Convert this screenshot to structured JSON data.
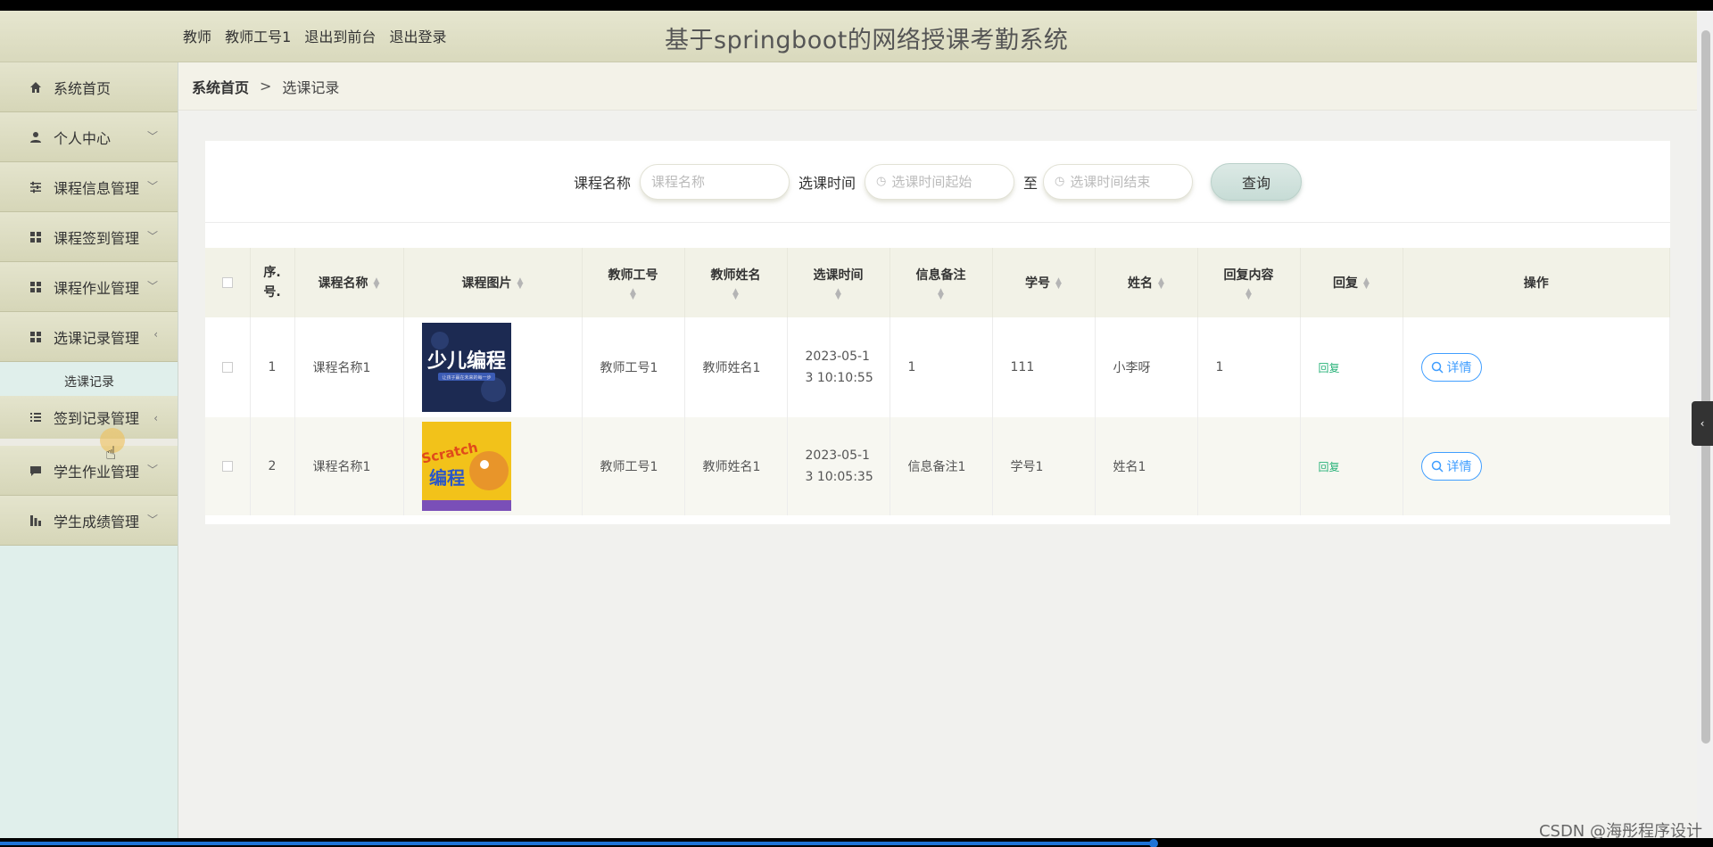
{
  "header": {
    "role": "教师",
    "username": "教师工号1",
    "back_to_front": "退出到前台",
    "logout": "退出登录",
    "app_title": "基于springboot的网络授课考勤系统"
  },
  "sidebar": {
    "items": [
      {
        "label": "系统首页",
        "icon": "home-icon"
      },
      {
        "label": "个人中心",
        "icon": "user-icon"
      },
      {
        "label": "课程信息管理",
        "icon": "sliders-icon"
      },
      {
        "label": "课程签到管理",
        "icon": "grid-icon"
      },
      {
        "label": "课程作业管理",
        "icon": "grid-icon"
      },
      {
        "label": "选课记录管理",
        "icon": "grid-icon"
      },
      {
        "label": "签到记录管理",
        "icon": "list-icon"
      },
      {
        "label": "学生作业管理",
        "icon": "chat-icon"
      },
      {
        "label": "学生成绩管理",
        "icon": "chart-icon"
      }
    ],
    "submenu_label": "选课记录"
  },
  "breadcrumb": {
    "home": "系统首页",
    "separator": ">",
    "current": "选课记录"
  },
  "search": {
    "course_name_label": "课程名称",
    "course_name_placeholder": "课程名称",
    "time_label": "选课时间",
    "time_start_placeholder": "选课时间起始",
    "to_label": "至",
    "time_end_placeholder": "选课时间结束",
    "query_button": "查询"
  },
  "table": {
    "headers": {
      "index": "序.号.",
      "course_name": "课程名称",
      "course_image": "课程图片",
      "teacher_id": "教师工号",
      "teacher_name": "教师姓名",
      "select_time": "选课时间",
      "remark": "信息备注",
      "student_id": "学号",
      "student_name": "姓名",
      "reply_content": "回复内容",
      "reply": "回复",
      "actions": "操作"
    },
    "rows": [
      {
        "index": "1",
        "course_name": "课程名称1",
        "image_text": "少儿编程",
        "image_subtext": "让孩子赢在未来的每一步",
        "teacher_id": "教师工号1",
        "teacher_name": "教师姓名1",
        "select_time_line1": "2023-05-1",
        "select_time_line2": "3 10:10:55",
        "remark": "1",
        "student_id": "111",
        "student_name": "小李呀",
        "reply_content": "1",
        "reply_link": "回复",
        "detail_button": "详情"
      },
      {
        "index": "2",
        "course_name": "课程名称1",
        "image_text": "Scratch",
        "image_subtext": "编程",
        "teacher_id": "教师工号1",
        "teacher_name": "教师姓名1",
        "select_time_line1": "2023-05-1",
        "select_time_line2": "3 10:05:35",
        "remark": "信息备注1",
        "student_id": "学号1",
        "student_name": "姓名1",
        "reply_content": "",
        "reply_link": "回复",
        "detail_button": "详情"
      }
    ]
  },
  "watermark": "CSDN @海彤程序设计",
  "colors": {
    "header_bg": "#dcdcc0",
    "sidebar_bg": "#e0efeb",
    "accent_blue": "#409eff",
    "reply_green": "#2bb37a"
  }
}
